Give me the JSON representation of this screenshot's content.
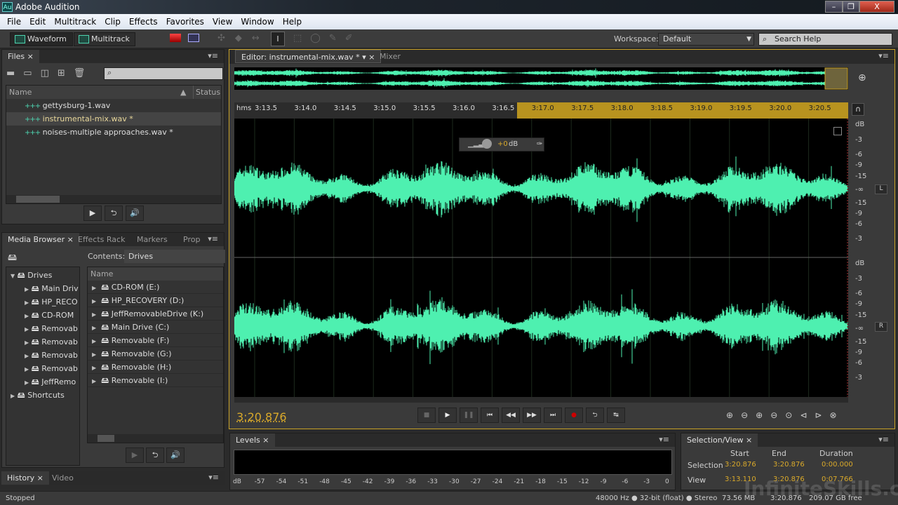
{
  "window": {
    "title": "Adobe Audition",
    "logo": "Au",
    "buttons": [
      "minimize",
      "restore",
      "close"
    ]
  },
  "menu": [
    "File",
    "Edit",
    "Multitrack",
    "Clip",
    "Effects",
    "Favorites",
    "View",
    "Window",
    "Help"
  ],
  "toolbar": {
    "waveform": "Waveform",
    "multitrack": "Multitrack",
    "workspace_label": "Workspace:",
    "workspace_value": "Default",
    "search_placeholder": "Search Help"
  },
  "files": {
    "tab": "Files",
    "col_name": "Name",
    "col_status": "Status",
    "items": [
      "gettysburg-1.wav",
      "instrumental-mix.wav *",
      "noises-multiple approaches.wav *"
    ],
    "selected_index": 1
  },
  "media": {
    "tabs": [
      "Media Browser",
      "Effects Rack",
      "Markers",
      "Prop"
    ],
    "contents_label": "Contents:",
    "contents_value": "Drives",
    "tree_root": "Drives",
    "tree": [
      "Main Driv",
      "HP_RECO",
      "CD-ROM",
      "Removab",
      "Removab",
      "Removab",
      "Removab",
      "JeffRemo"
    ],
    "shortcuts": "Shortcuts",
    "col_name": "Name",
    "list": [
      "CD-ROM (E:)",
      "HP_RECOVERY (D:)",
      "JeffRemovableDrive (K:)",
      "Main Drive (C:)",
      "Removable (F:)",
      "Removable (G:)",
      "Removable (H:)",
      "Removable (I:)"
    ]
  },
  "bottom_tabs": [
    "History",
    "Video"
  ],
  "editor": {
    "tab": "Editor: instrumental-mix.wav *",
    "mixer_tab": "Mixer",
    "ruler_unit": "hms",
    "ruler_ticks": [
      "3:13.5",
      "3:14.0",
      "3:14.5",
      "3:15.0",
      "3:15.5",
      "3:16.0",
      "3:16.5",
      "3:17.0",
      "3:17.5",
      "3:18.0",
      "3:18.5",
      "3:19.0",
      "3:19.5",
      "3:20.0",
      "3:20.5"
    ],
    "hud_gain": "+0",
    "hud_unit": "dB",
    "db_scale": [
      "dB",
      "-3",
      "-6",
      "-9",
      "-15",
      "-∞",
      "-15",
      "-9",
      "-6",
      "-3"
    ],
    "channels": [
      "L",
      "R"
    ],
    "current_time": "3:20.876",
    "waveform_color": "#4ef0b0"
  },
  "levels": {
    "tab": "Levels",
    "scale": [
      "dB",
      "-57",
      "-54",
      "-51",
      "-48",
      "-45",
      "-42",
      "-39",
      "-36",
      "-33",
      "-30",
      "-27",
      "-24",
      "-21",
      "-18",
      "-15",
      "-12",
      "-9",
      "-6",
      "-3",
      "0"
    ]
  },
  "selection_view": {
    "tab": "Selection/View",
    "headers": [
      "Start",
      "End",
      "Duration"
    ],
    "rows": [
      {
        "label": "Selection",
        "start": "3:20.876",
        "end": "3:20.876",
        "duration": "0:00.000"
      },
      {
        "label": "View",
        "start": "3:13.110",
        "end": "3:20.876",
        "duration": "0:07.766"
      }
    ]
  },
  "status": {
    "left": "Stopped",
    "format": "48000 Hz ● 32-bit (float) ● Stereo",
    "size": "73.56 MB",
    "duration": "3:20.876",
    "free": "209.07 GB free"
  },
  "watermark": "InfiniteSkills.com"
}
